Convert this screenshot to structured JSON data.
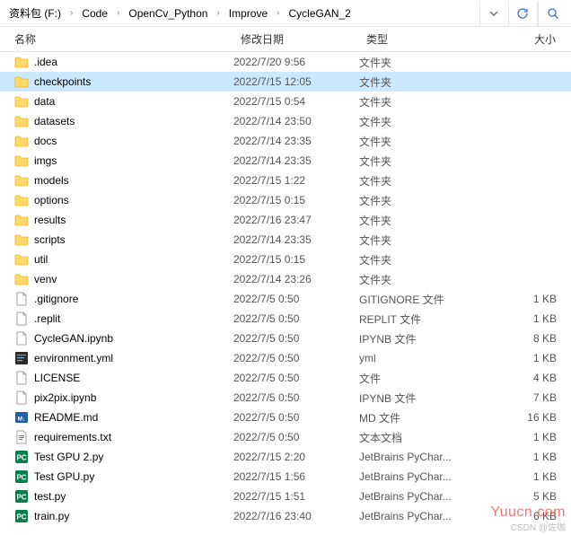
{
  "breadcrumb": {
    "items": [
      "资料包 (F:)",
      "Code",
      "OpenCv_Python",
      "Improve",
      "CycleGAN_2"
    ]
  },
  "columns": {
    "name": "名称",
    "date": "修改日期",
    "type": "类型",
    "size": "大小"
  },
  "files": [
    {
      "icon": "folder",
      "name": ".idea",
      "date": "2022/7/20 9:56",
      "type": "文件夹",
      "size": ""
    },
    {
      "icon": "folder",
      "name": "checkpoints",
      "date": "2022/7/15 12:05",
      "type": "文件夹",
      "size": "",
      "selected": true
    },
    {
      "icon": "folder",
      "name": "data",
      "date": "2022/7/15 0:54",
      "type": "文件夹",
      "size": ""
    },
    {
      "icon": "folder",
      "name": "datasets",
      "date": "2022/7/14 23:50",
      "type": "文件夹",
      "size": ""
    },
    {
      "icon": "folder",
      "name": "docs",
      "date": "2022/7/14 23:35",
      "type": "文件夹",
      "size": ""
    },
    {
      "icon": "folder",
      "name": "imgs",
      "date": "2022/7/14 23:35",
      "type": "文件夹",
      "size": ""
    },
    {
      "icon": "folder",
      "name": "models",
      "date": "2022/7/15 1:22",
      "type": "文件夹",
      "size": ""
    },
    {
      "icon": "folder",
      "name": "options",
      "date": "2022/7/15 0:15",
      "type": "文件夹",
      "size": ""
    },
    {
      "icon": "folder",
      "name": "results",
      "date": "2022/7/16 23:47",
      "type": "文件夹",
      "size": ""
    },
    {
      "icon": "folder",
      "name": "scripts",
      "date": "2022/7/14 23:35",
      "type": "文件夹",
      "size": ""
    },
    {
      "icon": "folder",
      "name": "util",
      "date": "2022/7/15 0:15",
      "type": "文件夹",
      "size": ""
    },
    {
      "icon": "folder",
      "name": "venv",
      "date": "2022/7/14 23:26",
      "type": "文件夹",
      "size": ""
    },
    {
      "icon": "file",
      "name": ".gitignore",
      "date": "2022/7/5 0:50",
      "type": "GITIGNORE 文件",
      "size": "1 KB"
    },
    {
      "icon": "file",
      "name": ".replit",
      "date": "2022/7/5 0:50",
      "type": "REPLIT 文件",
      "size": "1 KB"
    },
    {
      "icon": "file",
      "name": "CycleGAN.ipynb",
      "date": "2022/7/5 0:50",
      "type": "IPYNB 文件",
      "size": "8 KB"
    },
    {
      "icon": "yml",
      "name": "environment.yml",
      "date": "2022/7/5 0:50",
      "type": "yml",
      "size": "1 KB"
    },
    {
      "icon": "file",
      "name": "LICENSE",
      "date": "2022/7/5 0:50",
      "type": "文件",
      "size": "4 KB"
    },
    {
      "icon": "file",
      "name": "pix2pix.ipynb",
      "date": "2022/7/5 0:50",
      "type": "IPYNB 文件",
      "size": "7 KB"
    },
    {
      "icon": "md",
      "name": "README.md",
      "date": "2022/7/5 0:50",
      "type": "MD 文件",
      "size": "16 KB"
    },
    {
      "icon": "txt",
      "name": "requirements.txt",
      "date": "2022/7/5 0:50",
      "type": "文本文档",
      "size": "1 KB"
    },
    {
      "icon": "py",
      "name": "Test GPU 2.py",
      "date": "2022/7/15 2:20",
      "type": "JetBrains PyChar...",
      "size": "1 KB"
    },
    {
      "icon": "py",
      "name": "Test GPU.py",
      "date": "2022/7/15 1:56",
      "type": "JetBrains PyChar...",
      "size": "1 KB"
    },
    {
      "icon": "py",
      "name": "test.py",
      "date": "2022/7/15 1:51",
      "type": "JetBrains PyChar...",
      "size": "5 KB"
    },
    {
      "icon": "py",
      "name": "train.py",
      "date": "2022/7/16 23:40",
      "type": "JetBrains PyChar...",
      "size": "6 KB"
    }
  ],
  "watermark": "Yuucn.com",
  "attribution": "CSDN @佐咖"
}
